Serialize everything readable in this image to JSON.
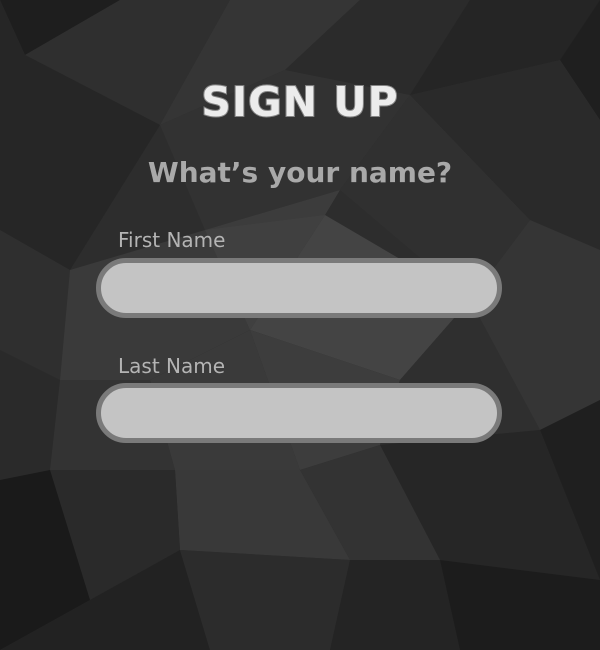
{
  "form": {
    "title": "SIGN UP",
    "subtitle": "What’s your name?",
    "first_name": {
      "label": "First Name",
      "value": "",
      "placeholder": ""
    },
    "last_name": {
      "label": "Last Name",
      "value": "",
      "placeholder": ""
    }
  },
  "colors": {
    "background": "#2b2b2b",
    "field_fill": "#c4c4c4",
    "field_border": "#7a7a7a",
    "label_text": "#b4b4b4",
    "subtitle_text": "#a9a9a9",
    "title_text": "#ececec"
  }
}
